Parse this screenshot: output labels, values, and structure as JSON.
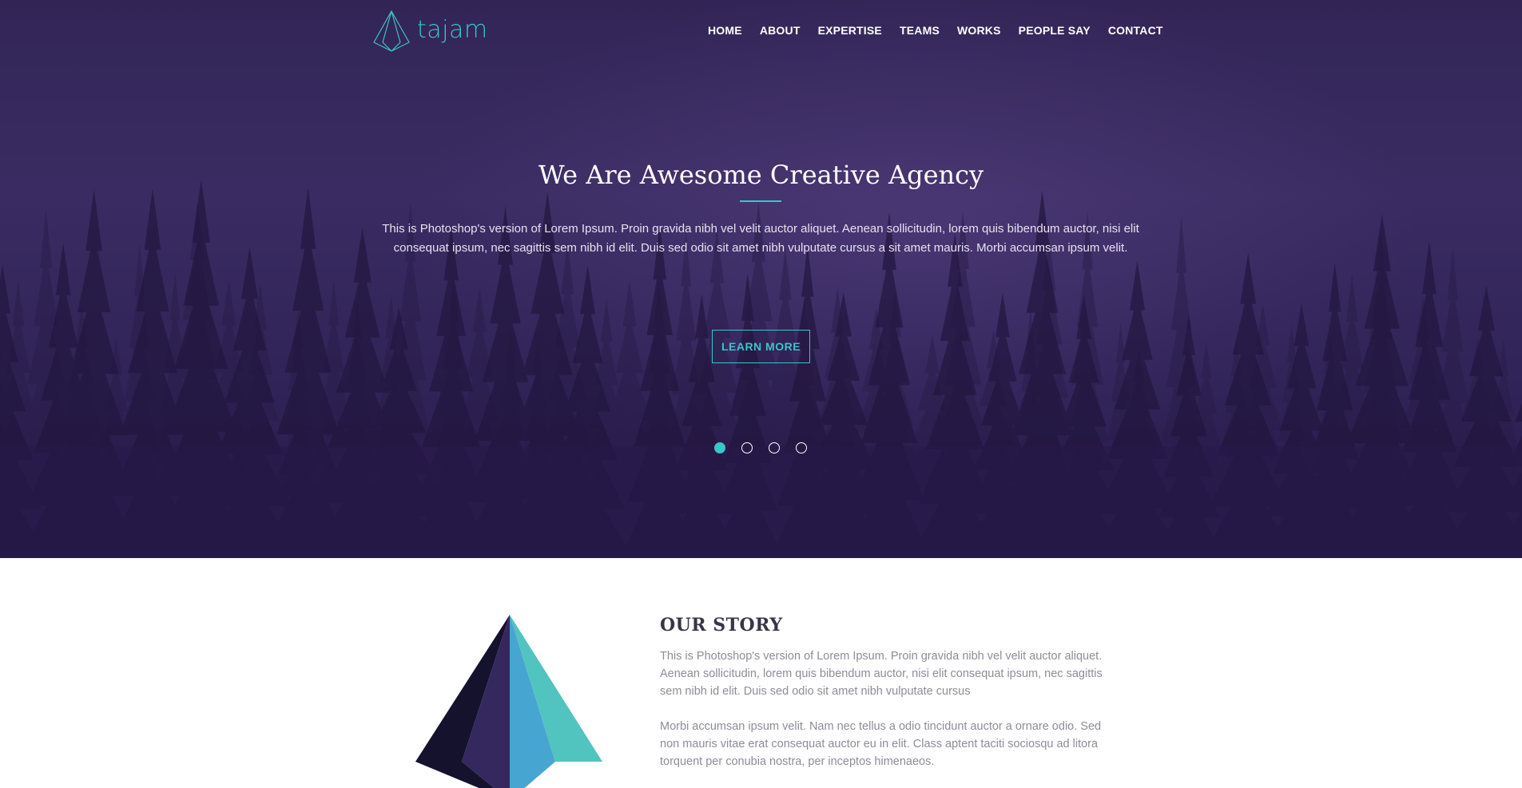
{
  "brand": {
    "name": "tajam",
    "icon": "paper-plane-pyramid-icon",
    "accent": "#3ec3c9"
  },
  "nav": {
    "items": [
      {
        "label": "HOME"
      },
      {
        "label": "ABOUT"
      },
      {
        "label": "EXPERTISE"
      },
      {
        "label": "TEAMS"
      },
      {
        "label": "WORKS"
      },
      {
        "label": "PEOPLE SAY"
      },
      {
        "label": "CONTACT"
      }
    ]
  },
  "hero": {
    "title": "We Are Awesome Creative Agency",
    "text": "This is Photoshop's version of Lorem Ipsum. Proin gravida nibh vel velit auctor aliquet. Aenean sollicitudin, lorem quis bibendum auctor, nisi elit consequat ipsum, nec sagittis sem nibh id elit. Duis sed odio sit amet nibh vulputate cursus a sit amet mauris. Morbi accumsan ipsum velit.",
    "button_label": "LEARN MORE",
    "slides": {
      "count": 4,
      "active": 1
    },
    "background": "#322556"
  },
  "story": {
    "title": "OUR STORY",
    "paragraph1": "This is Photoshop's version of Lorem Ipsum. Proin gravida nibh vel velit auctor aliquet. Aenean sollicitudin, lorem quis bibendum auctor, nisi elit consequat ipsum, nec sagittis sem nibh id elit. Duis sed odio sit amet nibh vulputate cursus",
    "paragraph2": "Morbi accumsan ipsum velit. Nam nec tellus a odio tincidunt auctor a ornare odio. Sed non mauris vitae erat consequat auctor eu in elit. Class aptent taciti sociosqu ad litora torquent per conubia nostra, per inceptos himenaeos.",
    "graphic": "paper-plane-pyramid-graphic"
  }
}
